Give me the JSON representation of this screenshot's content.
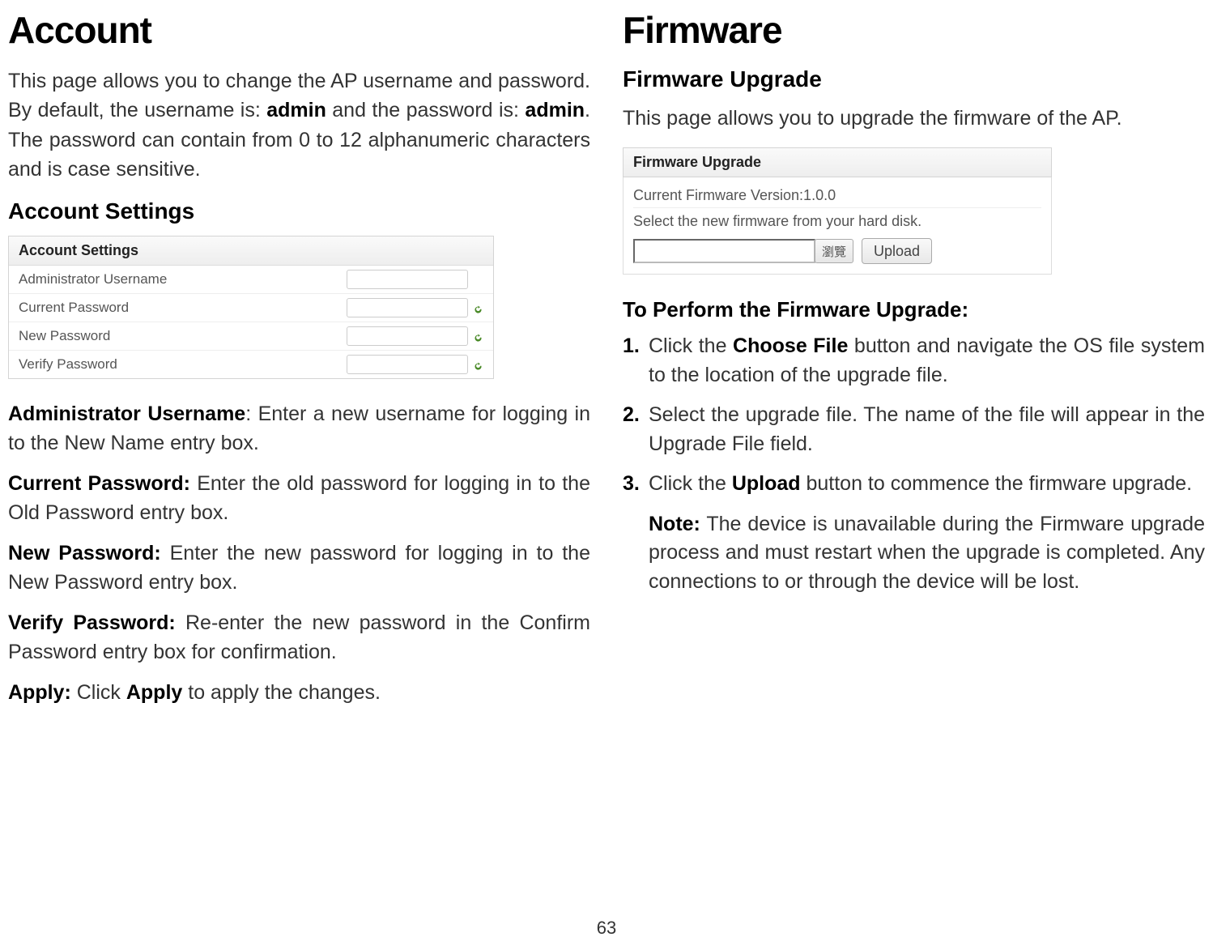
{
  "left": {
    "title": "Account",
    "intro_parts": {
      "p1": "This page allows you to change the AP username and password. By default, the username is: ",
      "b1": "admin",
      "p2": " and the password is: ",
      "b2": "admin",
      "p3": ". The password can contain from 0 to 12 alphanumeric characters and is case sensitive."
    },
    "subheading": "Account Settings",
    "settings_panel": {
      "header": "Account Settings",
      "rows": [
        {
          "label": "Administrator Username",
          "icon": false
        },
        {
          "label": "Current Password",
          "icon": true
        },
        {
          "label": "New Password",
          "icon": true
        },
        {
          "label": "Verify Password",
          "icon": true
        }
      ]
    },
    "fields": {
      "admin_user": {
        "label": "Administrator Username",
        "desc": ": Enter a new username for logging in to the New Name entry box."
      },
      "current_pw": {
        "label": "Current Password:",
        "desc": " Enter the old password for logging in to the Old Password entry box."
      },
      "new_pw": {
        "label": "New Password:",
        "desc": " Enter the new password for logging in to the New Password entry box."
      },
      "verify_pw": {
        "label": "Verify Password:",
        "desc": " Re-enter the new password in the Confirm Password entry box for confirmation."
      },
      "apply": {
        "label": "Apply:",
        "desc_pre": " Click ",
        "bold": "Apply",
        "desc_post": " to apply the changes."
      }
    }
  },
  "right": {
    "title": "Firmware",
    "sub1": "Firmware Upgrade",
    "intro": "This page allows you to upgrade the firmware of the AP.",
    "panel": {
      "header": "Firmware Upgrade",
      "version_line": "Current Firmware Version:1.0.0",
      "select_line": "Select the new firmware from your hard disk.",
      "browse_label": "瀏覽",
      "upload_label": "Upload"
    },
    "sub2": "To Perform the Firmware Upgrade:",
    "steps": [
      {
        "pre": "Click the ",
        "bold": "Choose File",
        "post": " button and navigate the OS file system to the location of the upgrade file."
      },
      {
        "pre": "Select the upgrade file. The name of the file will appear in the Upgrade File field.",
        "bold": "",
        "post": ""
      },
      {
        "pre": "Click the ",
        "bold": "Upload",
        "post": " button to commence the firmware upgrade."
      }
    ],
    "note": {
      "label": "Note:",
      "text": " The device is unavailable during the Firmware upgrade process and must restart when the upgrade is completed. Any connections to or through the device will be lost."
    }
  },
  "page_number": "63"
}
